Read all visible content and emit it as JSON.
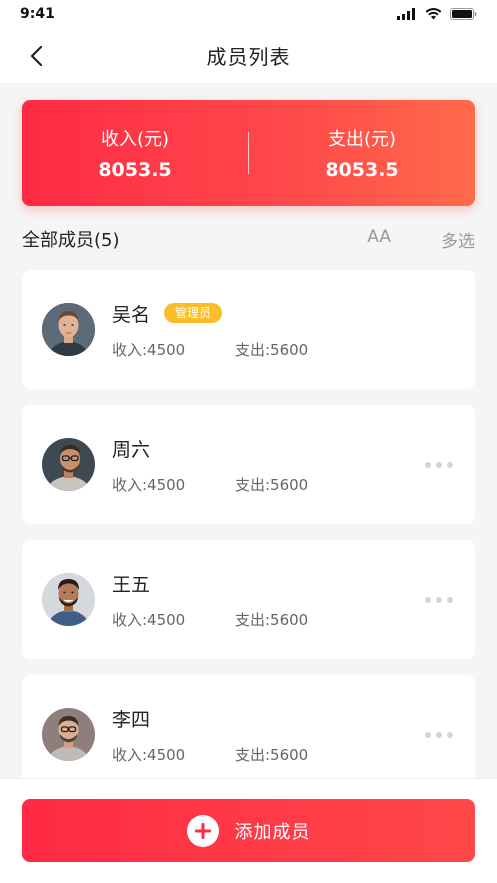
{
  "status_bar": {
    "time": "9:41"
  },
  "nav": {
    "title": "成员列表"
  },
  "summary": {
    "income_label": "收入(元)",
    "income_value": "8053.5",
    "expense_label": "支出(元)",
    "expense_value": "8053.5"
  },
  "section": {
    "title": "全部成员(5)",
    "aa_label": "AA",
    "multi_select_label": "多选"
  },
  "members": [
    {
      "name": "吴名",
      "badge": "管理员",
      "income": "收入:4500",
      "expense": "支出:5600",
      "avatar_icon": "avatar-man-1"
    },
    {
      "name": "周六",
      "income": "收入:4500",
      "expense": "支出:5600",
      "avatar_icon": "avatar-man-glasses"
    },
    {
      "name": "王五",
      "income": "收入:4500",
      "expense": "支出:5600",
      "avatar_icon": "avatar-man-beard"
    },
    {
      "name": "李四",
      "income": "收入:4500",
      "expense": "支出:5600",
      "avatar_icon": "avatar-man-glasses-2"
    }
  ],
  "bottom": {
    "add_label": "添加成员"
  },
  "colors": {
    "accent": "#ff2a45",
    "accent_end": "#ff6a4a",
    "badge": "#f9bd2a",
    "background": "#f5f5f5"
  }
}
